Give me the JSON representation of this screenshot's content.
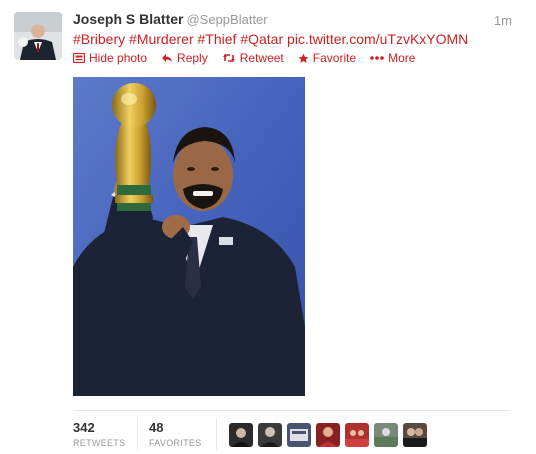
{
  "tweet": {
    "author_name": "Joseph S Blatter",
    "author_handle": "@SeppBlatter",
    "time": "1m",
    "hashtags": [
      "#Bribery",
      "#Murderer",
      "#Thief",
      "#Qatar"
    ],
    "link": "pic.twitter.com/uTzvKxYOMN"
  },
  "actions": {
    "hide_photo": "Hide photo",
    "reply": "Reply",
    "retweet": "Retweet",
    "favorite": "Favorite",
    "more": "More"
  },
  "stats": {
    "retweets_count": "342",
    "retweets_label": "RETWEETS",
    "favorites_count": "48",
    "favorites_label": "FAVORITES"
  },
  "favoriters": [
    {
      "color": "#2b2b2b"
    },
    {
      "color": "#3a3a3a"
    },
    {
      "color": "#4a5470"
    },
    {
      "color": "#8a2020"
    },
    {
      "color": "#b03030"
    },
    {
      "color": "#7a8a7a"
    },
    {
      "color": "#5a4a40"
    }
  ],
  "colors": {
    "link": "#cc2222",
    "muted": "#999999",
    "text": "#333333"
  }
}
